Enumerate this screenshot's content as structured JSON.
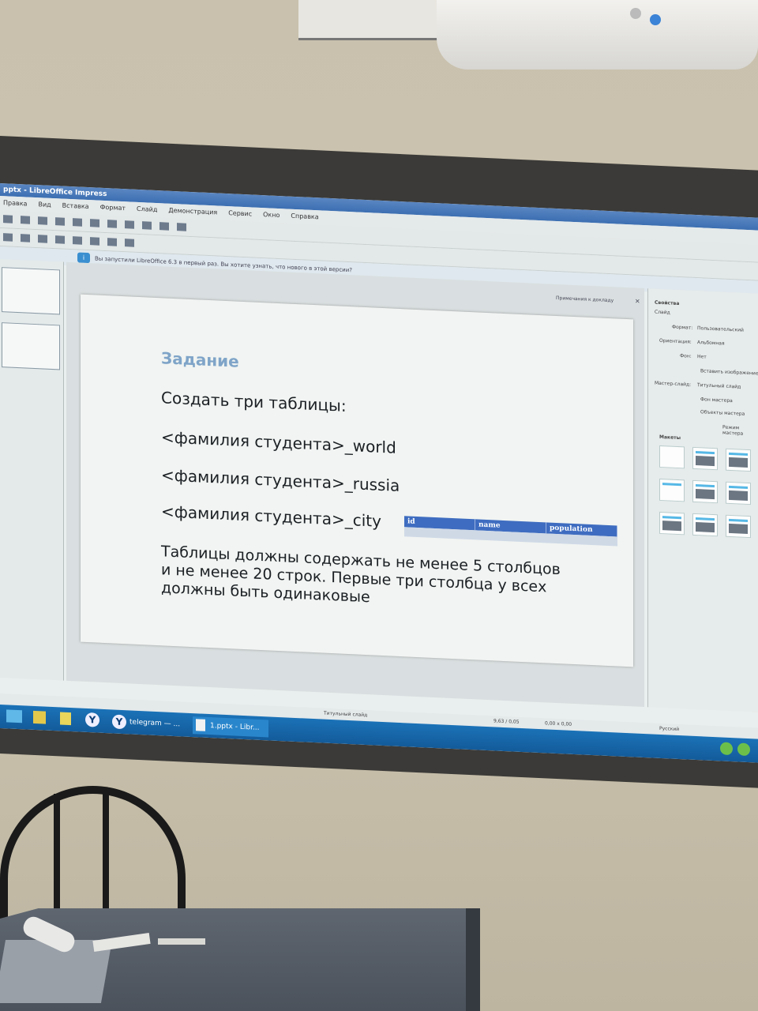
{
  "window": {
    "title": "pptx - LibreOffice Impress"
  },
  "menu": [
    "Правка",
    "Вид",
    "Вставка",
    "Формат",
    "Слайд",
    "Демонстрация",
    "Сервис",
    "Окно",
    "Справка"
  ],
  "infobar": {
    "text": "Вы запустили LibreOffice 6.3 в первый раз. Вы хотите узнать, что нового в этой версии?",
    "close": "×"
  },
  "notes_button": "Примечания к докладу",
  "slide": {
    "title": "Задание",
    "line1": "Создать три таблицы:",
    "line2": "<фамилия студента>_world",
    "line3": "<фамилия студента>_russia",
    "line4": "<фамилия студента>_city",
    "paragraph": "Таблицы должны содержать не менее 5 столбцов и не менее 20 строк. Первые три столбца у всех должны быть одинаковые",
    "table_headers": [
      "id",
      "name",
      "population"
    ]
  },
  "sidebar": {
    "heading": "Свойства",
    "section": "Слайд",
    "format_label": "Формат:",
    "format_value": "Пользовательский",
    "orientation_label": "Ориентация:",
    "orientation_value": "Альбомная",
    "background_label": "Фон:",
    "background_value": "Нет",
    "insert_image": "Вставить изображение",
    "master_label": "Мастер-слайд:",
    "master_value": "Титульный слайд",
    "master_bg": "Фон мастера",
    "master_objects": "Объекты мастера",
    "master_mode": "Режим мастера",
    "layouts": "Макеты"
  },
  "statusbar": {
    "slide_name": "Титульный слайд",
    "position": "9,63 / 0,05",
    "size": "0,00 x 0,00",
    "language": "Русский"
  },
  "taskbar": {
    "task1": "telegram — ...",
    "task2": "1.pptx - Libr..."
  }
}
